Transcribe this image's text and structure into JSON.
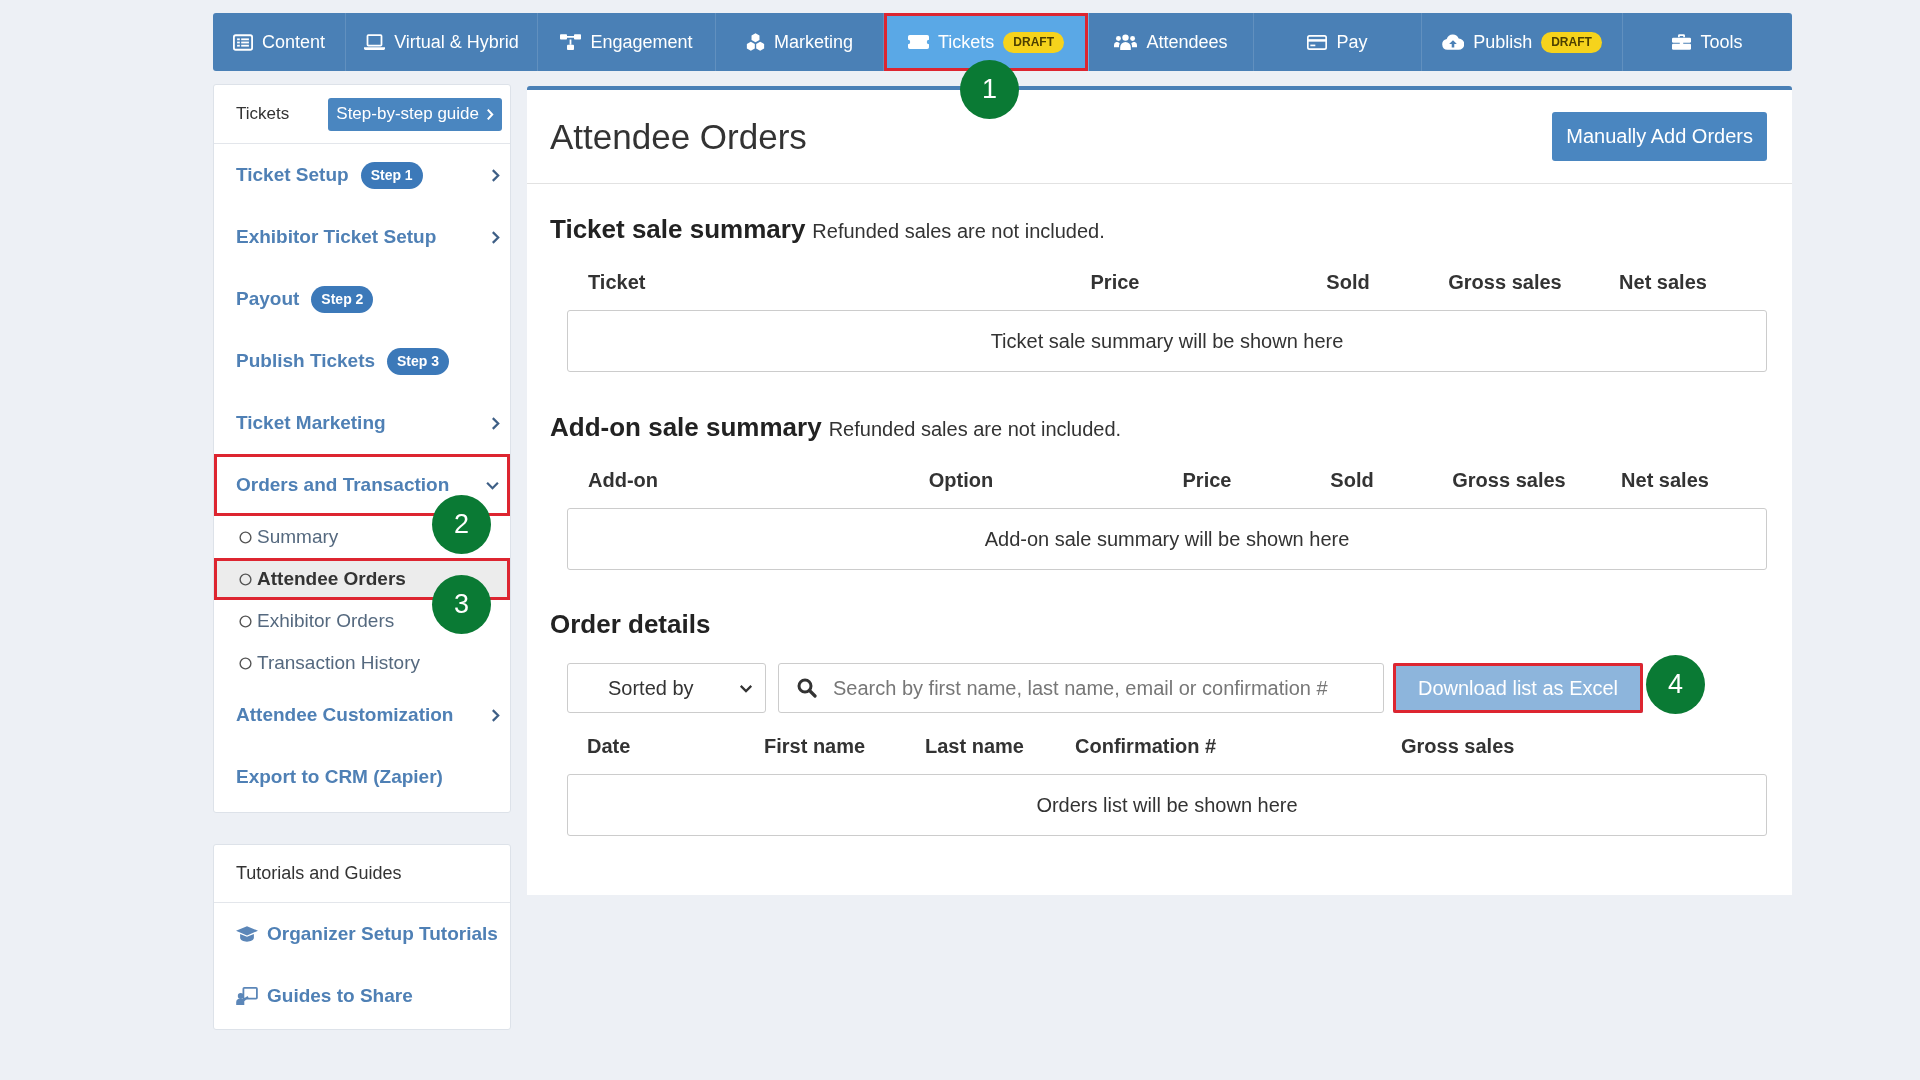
{
  "nav": {
    "tabs": [
      {
        "label": "Content",
        "selected": false
      },
      {
        "label": "Virtual & Hybrid",
        "selected": false
      },
      {
        "label": "Engagement",
        "selected": false
      },
      {
        "label": "Marketing",
        "selected": false
      },
      {
        "label": "Tickets",
        "selected": true,
        "badge": "DRAFT",
        "annotation": "1"
      },
      {
        "label": "Attendees",
        "selected": false
      },
      {
        "label": "Pay",
        "selected": false
      },
      {
        "label": "Publish",
        "selected": false,
        "badge": "DRAFT"
      },
      {
        "label": "Tools",
        "selected": false
      }
    ]
  },
  "sidebar": {
    "title": "Tickets",
    "guide_button": "Step-by-step guide",
    "items": [
      {
        "kind": "group",
        "label": "Ticket Setup",
        "badge": "Step 1",
        "expanded": false
      },
      {
        "kind": "group",
        "label": "Exhibitor Ticket Setup",
        "expanded": false
      },
      {
        "kind": "link",
        "label": "Payout",
        "badge": "Step 2"
      },
      {
        "kind": "link",
        "label": "Publish Tickets",
        "badge": "Step 3"
      },
      {
        "kind": "group",
        "label": "Ticket Marketing",
        "expanded": false
      },
      {
        "kind": "group",
        "label": "Orders and Transaction",
        "expanded": true,
        "annotation": "2",
        "children": [
          {
            "label": "Summary",
            "selected": false
          },
          {
            "label": "Attendee Orders",
            "selected": true,
            "annotation": "3"
          },
          {
            "label": "Exhibitor Orders",
            "selected": false
          },
          {
            "label": "Transaction History",
            "selected": false
          }
        ]
      },
      {
        "kind": "group",
        "label": "Attendee Customization",
        "expanded": false
      },
      {
        "kind": "link",
        "label": "Export to CRM (Zapier)"
      }
    ]
  },
  "tutorials": {
    "title": "Tutorials and Guides",
    "items": [
      {
        "label": "Organizer Setup Tutorials"
      },
      {
        "label": "Guides to Share"
      }
    ]
  },
  "main": {
    "title": "Attendee Orders",
    "add_button": "Manually Add Orders",
    "ticket_summary": {
      "title": "Ticket sale summary",
      "note": "Refunded sales are not included.",
      "columns": [
        "Ticket",
        "Price",
        "Sold",
        "Gross sales",
        "Net sales"
      ],
      "empty_text": "Ticket sale summary will be shown here"
    },
    "addon_summary": {
      "title": "Add-on sale summary",
      "note": "Refunded sales are not included.",
      "columns": [
        "Add-on",
        "Option",
        "Price",
        "Sold",
        "Gross sales",
        "Net sales"
      ],
      "empty_text": "Add-on sale summary will be shown here"
    },
    "order_details": {
      "title": "Order details",
      "sort_select": {
        "value": "Sorted by"
      },
      "search": {
        "placeholder": "Search by first name, last name, email or confirmation #"
      },
      "download_button": {
        "label": "Download list as Excel",
        "disabled": true,
        "annotation": "4"
      },
      "columns": [
        "Date",
        "First name",
        "Last name",
        "Confirmation #",
        "Gross sales"
      ],
      "empty_text": "Orders list will be shown here"
    }
  }
}
